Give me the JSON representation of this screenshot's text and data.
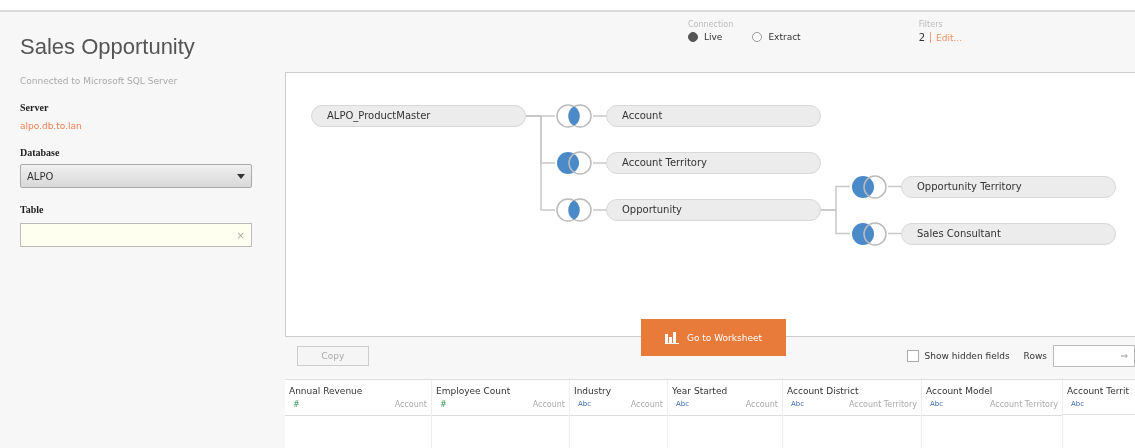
{
  "title": "Sales Opportunity",
  "connected_to": "Connected to Microsoft SQL Server",
  "server": {
    "label": "Server",
    "value": "alpo.db.to.lan"
  },
  "database": {
    "label": "Database",
    "value": "ALPO"
  },
  "table": {
    "label": "Table",
    "clear": "×"
  },
  "connection": {
    "label": "Connection",
    "options": [
      {
        "label": "Live",
        "selected": true
      },
      {
        "label": "Extract",
        "selected": false
      }
    ]
  },
  "filters": {
    "label": "Filters",
    "count": "2",
    "edit": "Edit..."
  },
  "join_diagram": {
    "name": "ALPO_ProductMaster",
    "children": [
      {
        "name": "Account",
        "kind": "inner"
      },
      {
        "name": "Account Territory",
        "kind": "left"
      },
      {
        "name": "Opportunity",
        "kind": "inner",
        "children": [
          {
            "name": "Opportunity Territory",
            "kind": "left"
          },
          {
            "name": "Sales Consultant",
            "kind": "left"
          }
        ]
      }
    ]
  },
  "go_button": "Go to Worksheet",
  "copy_button": "Copy",
  "show_hidden_fields": {
    "label": "Show hidden fields",
    "checked": false
  },
  "rows_label": "Rows",
  "rows_submit": "⇒",
  "grid": {
    "columns": [
      {
        "name": "Annual Revenue",
        "type": "#",
        "table": "Account",
        "kind": "number"
      },
      {
        "name": "Employee Count",
        "type": "#",
        "table": "Account",
        "kind": "number"
      },
      {
        "name": "Industry",
        "type": "Abc",
        "table": "Account",
        "kind": "string"
      },
      {
        "name": "Year Started",
        "type": "Abc",
        "table": "Account",
        "kind": "string"
      },
      {
        "name": "Account District",
        "type": "Abc",
        "table": "Account Territory",
        "kind": "string"
      },
      {
        "name": "Account Model",
        "type": "Abc",
        "table": "Account Territory",
        "kind": "string"
      },
      {
        "name": "Account Territ",
        "type": "Abc",
        "kind": "string"
      }
    ]
  }
}
